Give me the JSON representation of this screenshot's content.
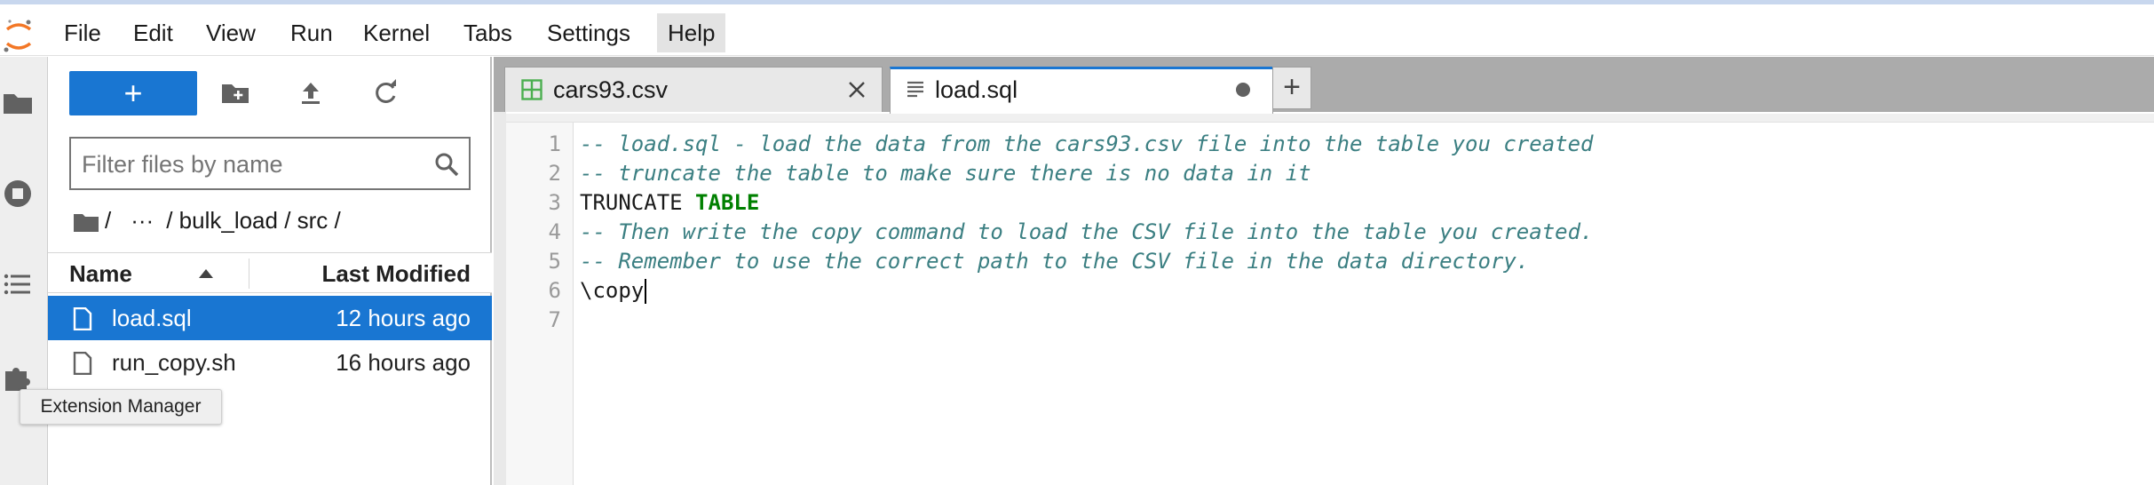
{
  "menubar": {
    "items": [
      "File",
      "Edit",
      "View",
      "Run",
      "Kernel",
      "Tabs",
      "Settings",
      "Help"
    ],
    "active": "Help"
  },
  "toolbar": {
    "new_label": "+"
  },
  "filebrowser": {
    "filter_placeholder": "Filter files by name",
    "breadcrumb": {
      "root": "/",
      "ellipsis": "···",
      "path": "/ bulk_load / src /"
    },
    "columns": {
      "name": "Name",
      "modified": "Last Modified"
    },
    "files": [
      {
        "name": "load.sql",
        "modified": "12 hours ago",
        "selected": true
      },
      {
        "name": "run_copy.sh",
        "modified": "16 hours ago",
        "selected": false
      }
    ]
  },
  "tooltip": "Extension Manager",
  "tabs": [
    {
      "label": "cars93.csv",
      "icon": "spreadsheet-icon",
      "action": "close"
    },
    {
      "label": "load.sql",
      "icon": "text-file-icon",
      "action": "unsaved-dot"
    }
  ],
  "tab_add": "+",
  "editor": {
    "line_numbers": [
      "1",
      "2",
      "3",
      "4",
      "5",
      "6",
      "7"
    ],
    "lines": [
      {
        "parts": [
          {
            "t": "-- load.sql - load the data from the cars93.csv file into the table you created",
            "c": "cmt"
          }
        ]
      },
      {
        "parts": [
          {
            "t": "-- truncate the table to make sure there is no data in it",
            "c": "cmt"
          }
        ]
      },
      {
        "parts": [
          {
            "t": "TRUNCATE ",
            "c": "plain"
          },
          {
            "t": "TABLE",
            "c": "kw"
          }
        ]
      },
      {
        "parts": [
          {
            "t": "-- Then write the copy command to load the CSV file into the table you created.",
            "c": "cmt"
          }
        ]
      },
      {
        "parts": [
          {
            "t": "-- Remember to use the correct path to the CSV file in the data directory.",
            "c": "cmt"
          }
        ]
      },
      {
        "parts": [
          {
            "t": "\\copy",
            "c": "plain"
          }
        ],
        "cursor": true
      },
      {
        "parts": []
      }
    ]
  },
  "colors": {
    "accent": "#1976d2",
    "comment": "#3b7f82",
    "keyword": "#008000",
    "logo": "#f37726"
  }
}
